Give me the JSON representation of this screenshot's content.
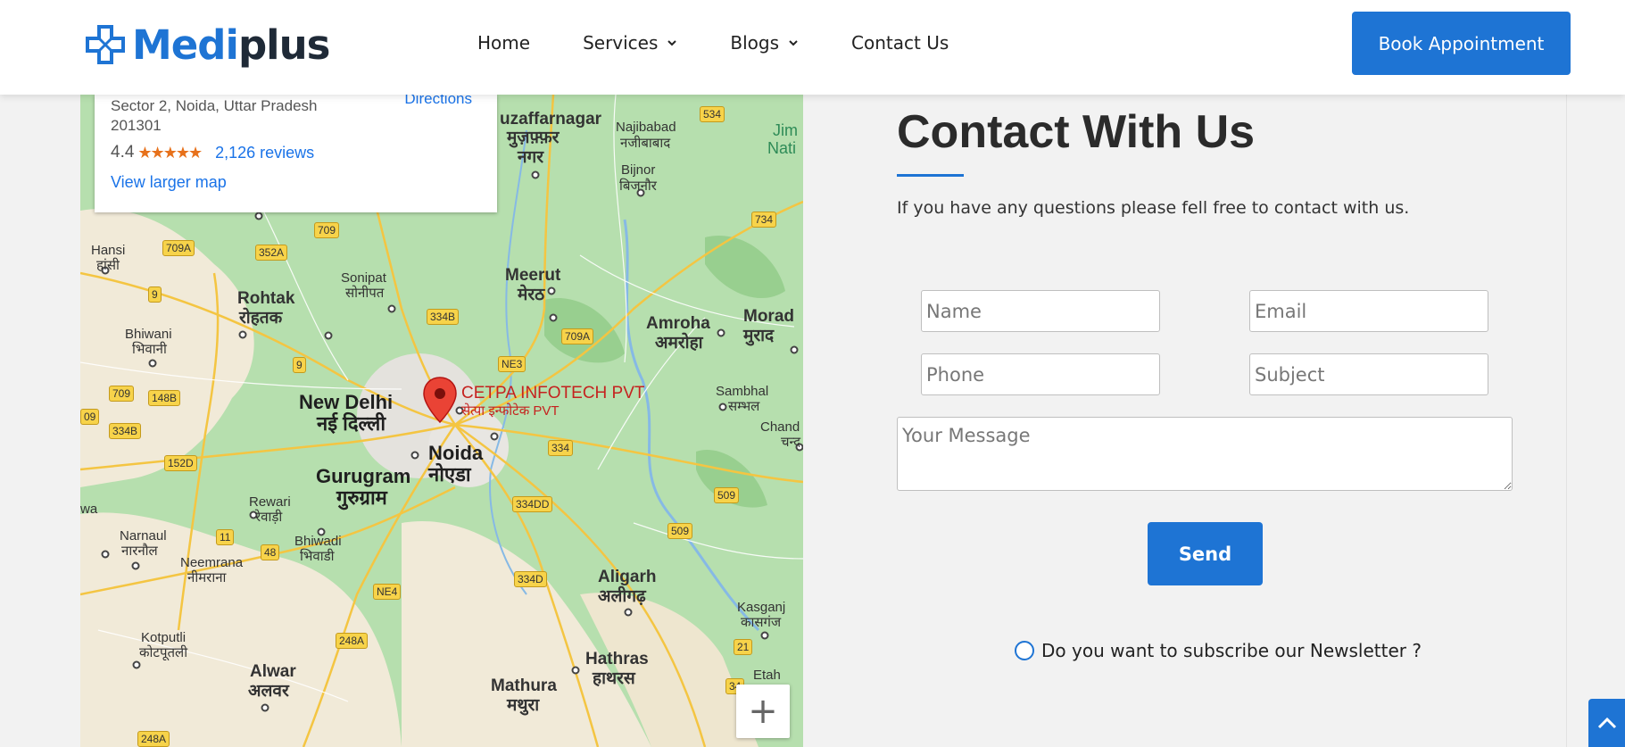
{
  "header": {
    "logo": {
      "part1": "Medi",
      "part2": "plus"
    },
    "nav": [
      {
        "label": "Home"
      },
      {
        "label": "Services"
      },
      {
        "label": "Blogs"
      },
      {
        "label": "Contact Us"
      }
    ],
    "cta": "Book Appointment"
  },
  "map": {
    "card": {
      "address_line1": "Sector 2, Noida, Uttar Pradesh",
      "address_line2": "201301",
      "directions": "Directions",
      "rating": "4.4",
      "stars": "★★★★★",
      "reviews": "2,126 reviews",
      "larger_map": "View larger map"
    },
    "pin": {
      "label_en": "CETPA INFOTECH PVT",
      "label_hi": "सेत्पा इन्फोटेक PVT"
    },
    "places": {
      "muzaffarnagar": "uzaffarnagar",
      "muzaffarnagar_hi1": "मुज़फ़्फ़र",
      "muzaffarnagar_hi2": "नगर",
      "najibabad": "Najibabad",
      "najibabad_hi": "नजीबाबाद",
      "bijnor": "Bijnor",
      "bijnor_hi": "बिजनौर",
      "hansi": "Hansi",
      "hansi_hi": "हांसी",
      "rohtak": "Rohtak",
      "rohtak_hi": "रोहतक",
      "sonipat": "Sonipat",
      "sonipat_hi": "सोनीपत",
      "meerut": "Meerut",
      "meerut_hi": "मेरठ",
      "amroha": "Amroha",
      "amroha_hi": "अमरोहा",
      "morad": "Morad",
      "morad_hi": "मुराद",
      "bhiwani": "Bhiwani",
      "bhiwani_hi": "भिवानी",
      "newdelhi": "New Delhi",
      "newdelhi_hi": "नई दिल्ली",
      "noida": "Noida",
      "noida_hi": "नोएडा",
      "gurugram": "Gurugram",
      "gurugram_hi": "गुरुग्राम",
      "sambhal": "Sambhal",
      "sambhal_hi": "सम्भल",
      "chand": "Chand",
      "chand_hi": "चन्द",
      "rewari": "Rewari",
      "rewari_hi": "रेवाड़ी",
      "bhiwadi": "Bhiwadi",
      "bhiwadi_hi": "भिवाडी",
      "narnaul": "Narnaul",
      "narnaul_hi": "नारनौल",
      "neemrana": "Neemrana",
      "neemrana_hi": "नीमराना",
      "aligarh": "Aligarh",
      "aligarh_hi": "अलीगढ़",
      "kasganj": "Kasganj",
      "kasganj_hi": "कासगंज",
      "kotputli": "Kotputli",
      "kotputli_hi": "कोटपूतली",
      "hathras": "Hathras",
      "hathras_hi": "हाथरस",
      "alwar": "Alwar",
      "alwar_hi": "अलवर",
      "mathura": "Mathura",
      "mathura_hi": "मथुरा",
      "etah": "Etah",
      "jim": "Jim",
      "nati": "Nati",
      "wa": "wa"
    },
    "shields": [
      "534",
      "709",
      "734",
      "709A",
      "352A",
      "9",
      "334B",
      "709A",
      "NE3",
      "9",
      "709",
      "148B",
      "09",
      "334B",
      "334",
      "152D",
      "334DD",
      "509",
      "509",
      "11",
      "48",
      "NE4",
      "334D",
      "248A",
      "21",
      "34",
      "248A"
    ],
    "zoom_in": "+"
  },
  "contact": {
    "title": "Contact With Us",
    "description": "If you have any questions please fell free to contact with us.",
    "placeholders": {
      "name": "Name",
      "email": "Email",
      "phone": "Phone",
      "subject": "Subject",
      "message": "Your Message"
    },
    "send": "Send",
    "newsletter": "Do you want to subscribe our Newsletter ?"
  },
  "colors": {
    "brand": "#1e74d4",
    "text_dark": "#2b2b2b"
  }
}
